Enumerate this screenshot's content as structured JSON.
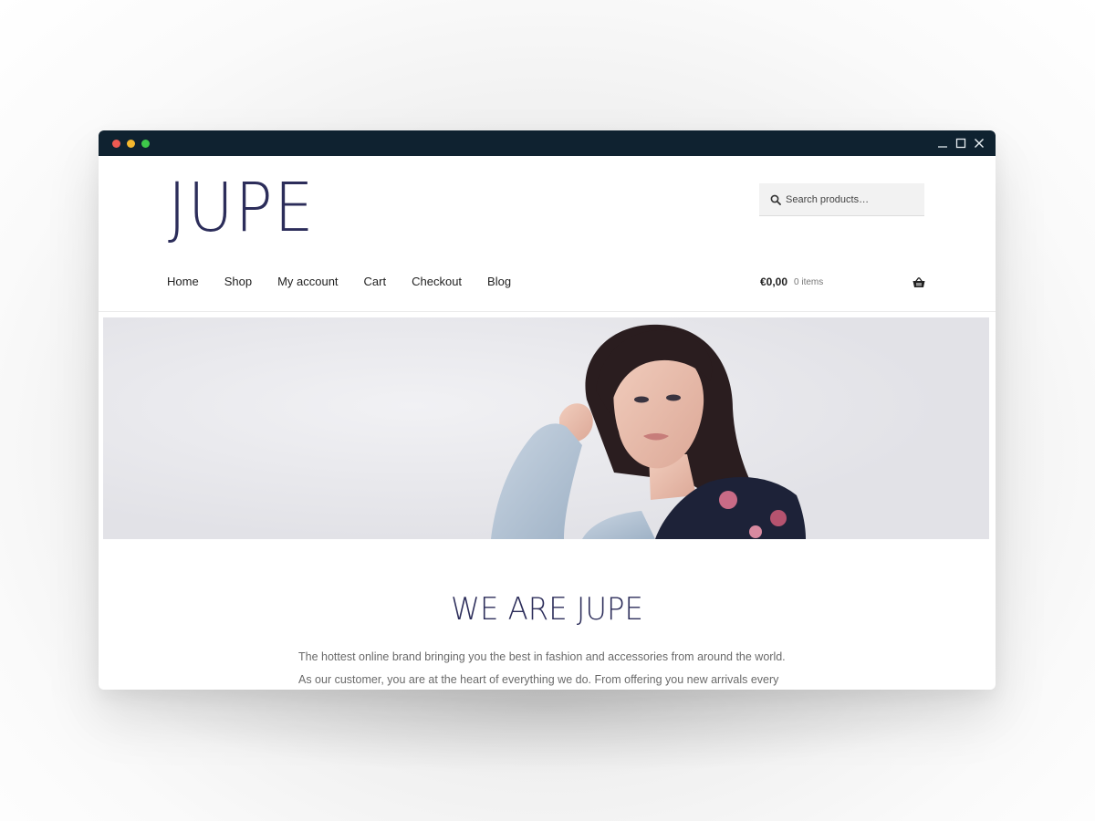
{
  "site": {
    "logo": "JUPE"
  },
  "search": {
    "placeholder": "Search products…",
    "icon": "search-icon"
  },
  "nav": {
    "items": [
      {
        "label": "Home"
      },
      {
        "label": "Shop"
      },
      {
        "label": "My account"
      },
      {
        "label": "Cart"
      },
      {
        "label": "Checkout"
      },
      {
        "label": "Blog"
      }
    ]
  },
  "cart": {
    "amount": "€0,00",
    "count": "0 items",
    "icon": "basket-icon"
  },
  "hero": {
    "image": "woman-in-denim-jacket-photo"
  },
  "intro": {
    "title": "WE ARE JUPE",
    "text": "The hottest online brand bringing you the best in fashion and accessories from around the world. As our customer, you are at the heart of everything we do. From offering you new arrivals every day and"
  },
  "colors": {
    "titlebar": "#0f2230",
    "brand": "#2c2d5a",
    "traffic_red": "#ee5a52",
    "traffic_yellow": "#f5b82e",
    "traffic_green": "#3ec84a"
  }
}
